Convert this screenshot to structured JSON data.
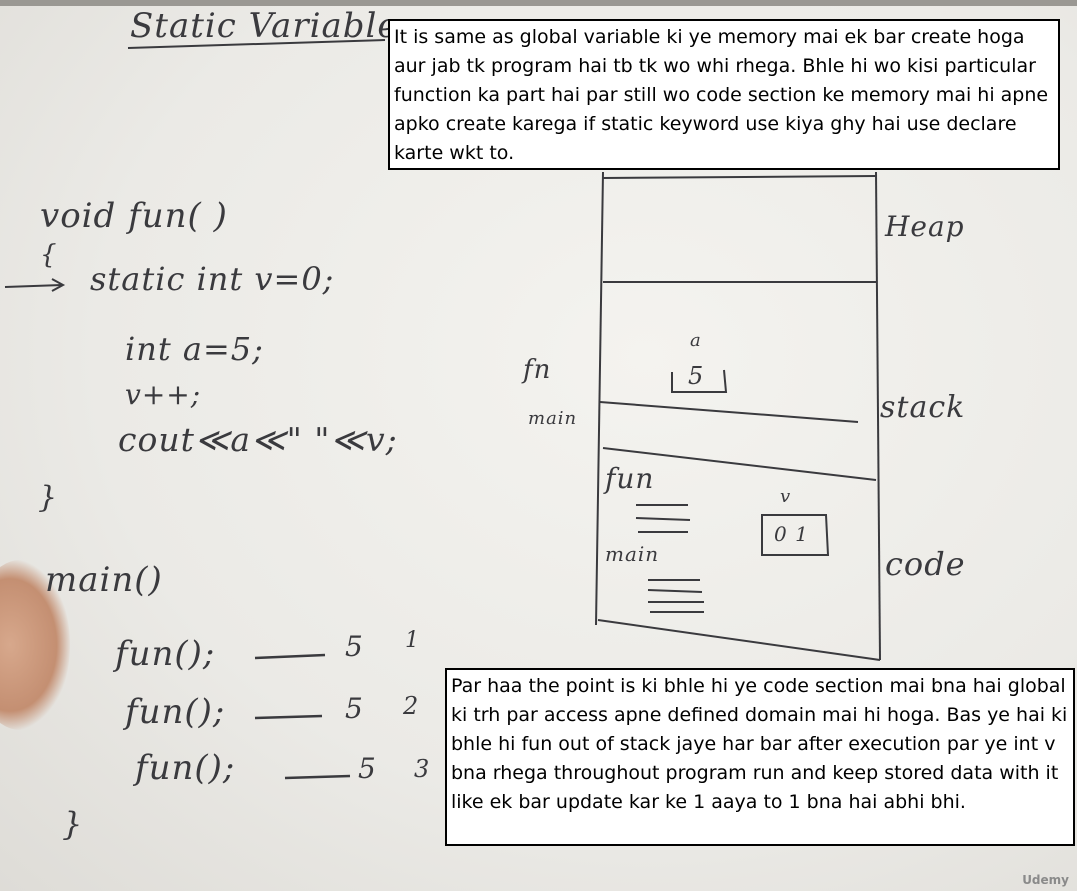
{
  "board": {
    "title": "Static Variables",
    "code": {
      "line1": "void fun( )",
      "line2": "{",
      "line3": "static int v=0;",
      "line4": "int a=5;",
      "line5": "v++;",
      "line6": "cout≪a≪\" \"≪v;",
      "line7": "}",
      "main": "main()",
      "call1": "fun();",
      "call2": "fun();",
      "call3": "fun();",
      "close": "}"
    },
    "outputs": [
      {
        "a": "5",
        "v": "1"
      },
      {
        "a": "5",
        "v": "2"
      },
      {
        "a": "5",
        "v": "3"
      }
    ],
    "memory": {
      "heap_label": "Heap",
      "stack_label": "stack",
      "code_label": "code",
      "fn_label": "fn",
      "main_label": "main",
      "code_fun_label": "fun",
      "code_main_label": "main",
      "a_label": "a",
      "a_value": "5",
      "v_label": "v",
      "v_value": "0 1"
    }
  },
  "notes": {
    "top": "It is same as global variable ki ye memory mai ek bar create hoga aur jab tk program hai tb tk wo whi rhega. Bhle hi wo kisi particular function ka part hai par still wo code section ke memory mai hi apne apko create karega if static keyword use kiya ghy hai use declare karte wkt to.",
    "bottom": "Par haa the point is ki bhle hi ye code section mai bna hai global ki trh par access apne defined domain mai hi hoga. Bas ye hai ki bhle hi fun out of stack jaye har bar after execution par ye int v bna rhega throughout program run and keep stored data with it like ek bar update kar ke 1 aaya to 1 bna hai abhi bhi."
  },
  "watermark": "Udemy"
}
